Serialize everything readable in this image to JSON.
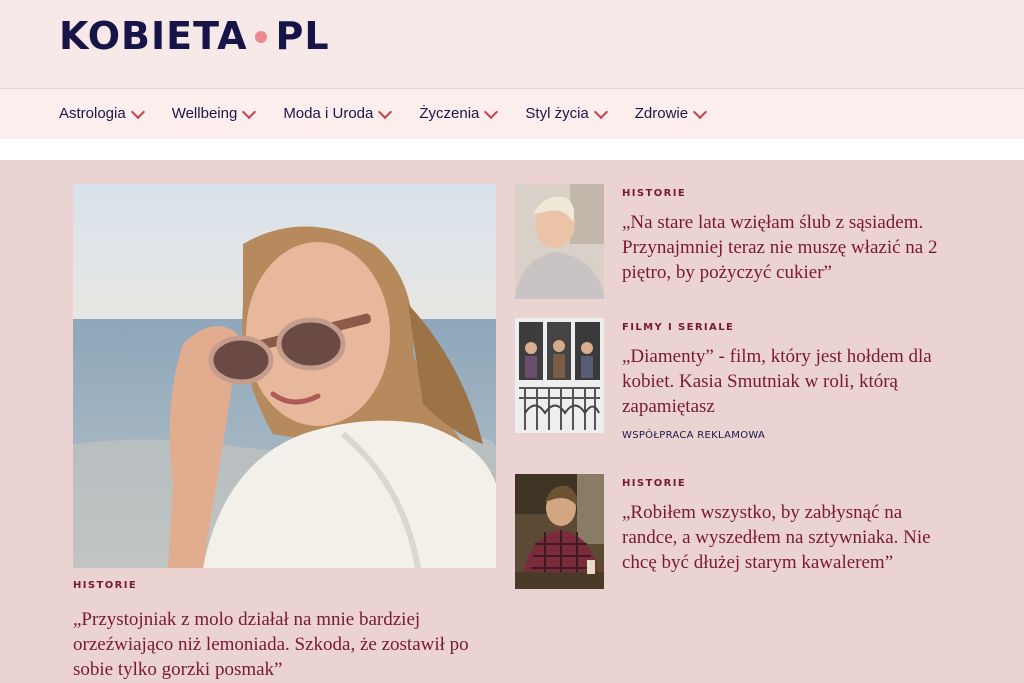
{
  "site": {
    "logo_left": "KOBIETA",
    "logo_right": "PL"
  },
  "nav": {
    "items": [
      {
        "label": "Astrologia"
      },
      {
        "label": "Wellbeing"
      },
      {
        "label": "Moda i Uroda"
      },
      {
        "label": "Życzenia"
      },
      {
        "label": "Styl życia"
      },
      {
        "label": "Zdrowie"
      }
    ]
  },
  "hero": {
    "category": "HISTORIE",
    "title": "„Przystojniak z molo działał na mnie bardziej orzeźwiająco niż lemoniada. Szkoda, że zostawił po sobie tylko gorzki posmak”"
  },
  "articles": [
    {
      "category": "HISTORIE",
      "title": "„Na stare lata wzięłam ślub z sąsiadem. Przynajmniej teraz nie muszę włazić na 2 piętro, by pożyczyć cukier”"
    },
    {
      "category": "FILMY I SERIALE",
      "title": "„Diamenty” - film, który jest hołdem dla kobiet. Kasia Smutniak w roli, którą zapamiętasz",
      "sponsor": "WSPÓŁPRACA REKLAMOWA"
    },
    {
      "category": "HISTORIE",
      "title": "„Robiłem wszystko, by zabłysnąć na randce, a wyszedłem na sztywniaka. Nie chcę być dłużej starym kawalerem”"
    }
  ],
  "colors": {
    "brand_navy": "#171447",
    "accent_pink": "#ea8a8c",
    "headline_red": "#7a1a2d",
    "chevron_red": "#c4424f",
    "page_bg": "#ebd3d2"
  }
}
